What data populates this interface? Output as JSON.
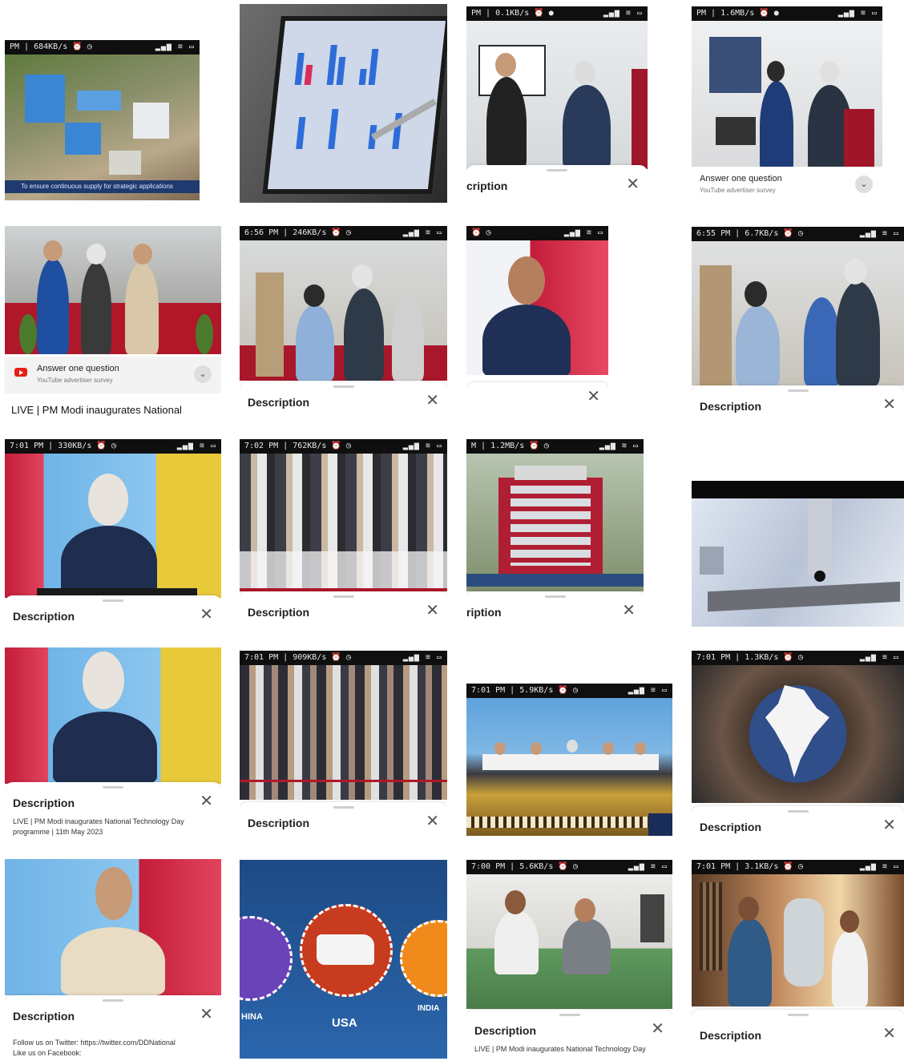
{
  "status_bars": {
    "t1": {
      "left": "PM | 684KB/s ⏰ ◷",
      "right": "▂▄▆ ≋ ▭"
    },
    "t3": {
      "left": "PM | 0.1KB/s ⏰ ●",
      "right": "▂▄▆ ≋ ▭"
    },
    "t4": {
      "left": "PM | 1.6MB/s ⏰ ●",
      "right": "▂▄▆ ≋ ▭"
    },
    "t6": {
      "left": "6:56 PM | 246KB/s ⏰ ◷",
      "right": "▂▄▆ ≋ ▭"
    },
    "t7": {
      "left": "⏰ ◷",
      "right": "▂▄▆ ≋ ▭"
    },
    "t8": {
      "left": "6:55 PM | 6.7KB/s ⏰ ◷",
      "right": "▂▄▆ ≋ ▭"
    },
    "t9": {
      "left": "7:01 PM | 330KB/s ⏰ ◷",
      "right": "▂▄▆ ≋ ▭"
    },
    "t10": {
      "left": "7:02 PM | 762KB/s ⏰ ◷",
      "right": "▂▄▆ ≋ ▭"
    },
    "t11": {
      "left": "M | 1.2MB/s ⏰ ◷",
      "right": "▂▄▆ ≋ ▭"
    },
    "t14": {
      "left": "7:01 PM | 909KB/s ⏰ ◷",
      "right": "▂▄▆ ≋ ▭"
    },
    "t15": {
      "left": "7:01 PM | 5.9KB/s ⏰ ◷",
      "right": "▂▄▆ ≋ ▭"
    },
    "t16": {
      "left": "7:01 PM | 1.3KB/s ⏰ ◷",
      "right": "▂▄▆ ≋ ▭"
    },
    "t19": {
      "left": "7:00 PM | 5.6KB/s ⏰ ◷",
      "right": "▂▄▆ ≋ ▭"
    },
    "t20": {
      "left": "7:01 PM | 3.1KB/s ⏰ ◷",
      "right": "▂▄▆ ≋ ▭"
    }
  },
  "captions": {
    "t1": "To ensure continuous supply for strategic applications"
  },
  "sheets": {
    "description": "Description",
    "cut_description": "cription",
    "cut_description2": "ription",
    "close": "✕",
    "t13_sub": "LIVE | PM Modi inaugurates National Technology Day",
    "t13_sub2": "programme | 11th May 2023",
    "t17_sub": "Follow us on Twitter: https://twitter.com/DDNational",
    "t17_sub2": "Like us on Facebook:",
    "t19_sub": "LIVE | PM Modi inaugurates National Technology Day"
  },
  "ads": {
    "question": "Answer one question",
    "survey": "YouTube advertiser survey",
    "chevron": "⌄"
  },
  "live_title": "LIVE | PM Modi inaugurates National",
  "map_labels": {
    "china": "HINA",
    "usa": "USA",
    "india": "INDIA"
  },
  "colors": {
    "accent_red": "#e62117",
    "stage_blue": "#6fb4e8",
    "stage_yellow": "#e8c93a"
  }
}
